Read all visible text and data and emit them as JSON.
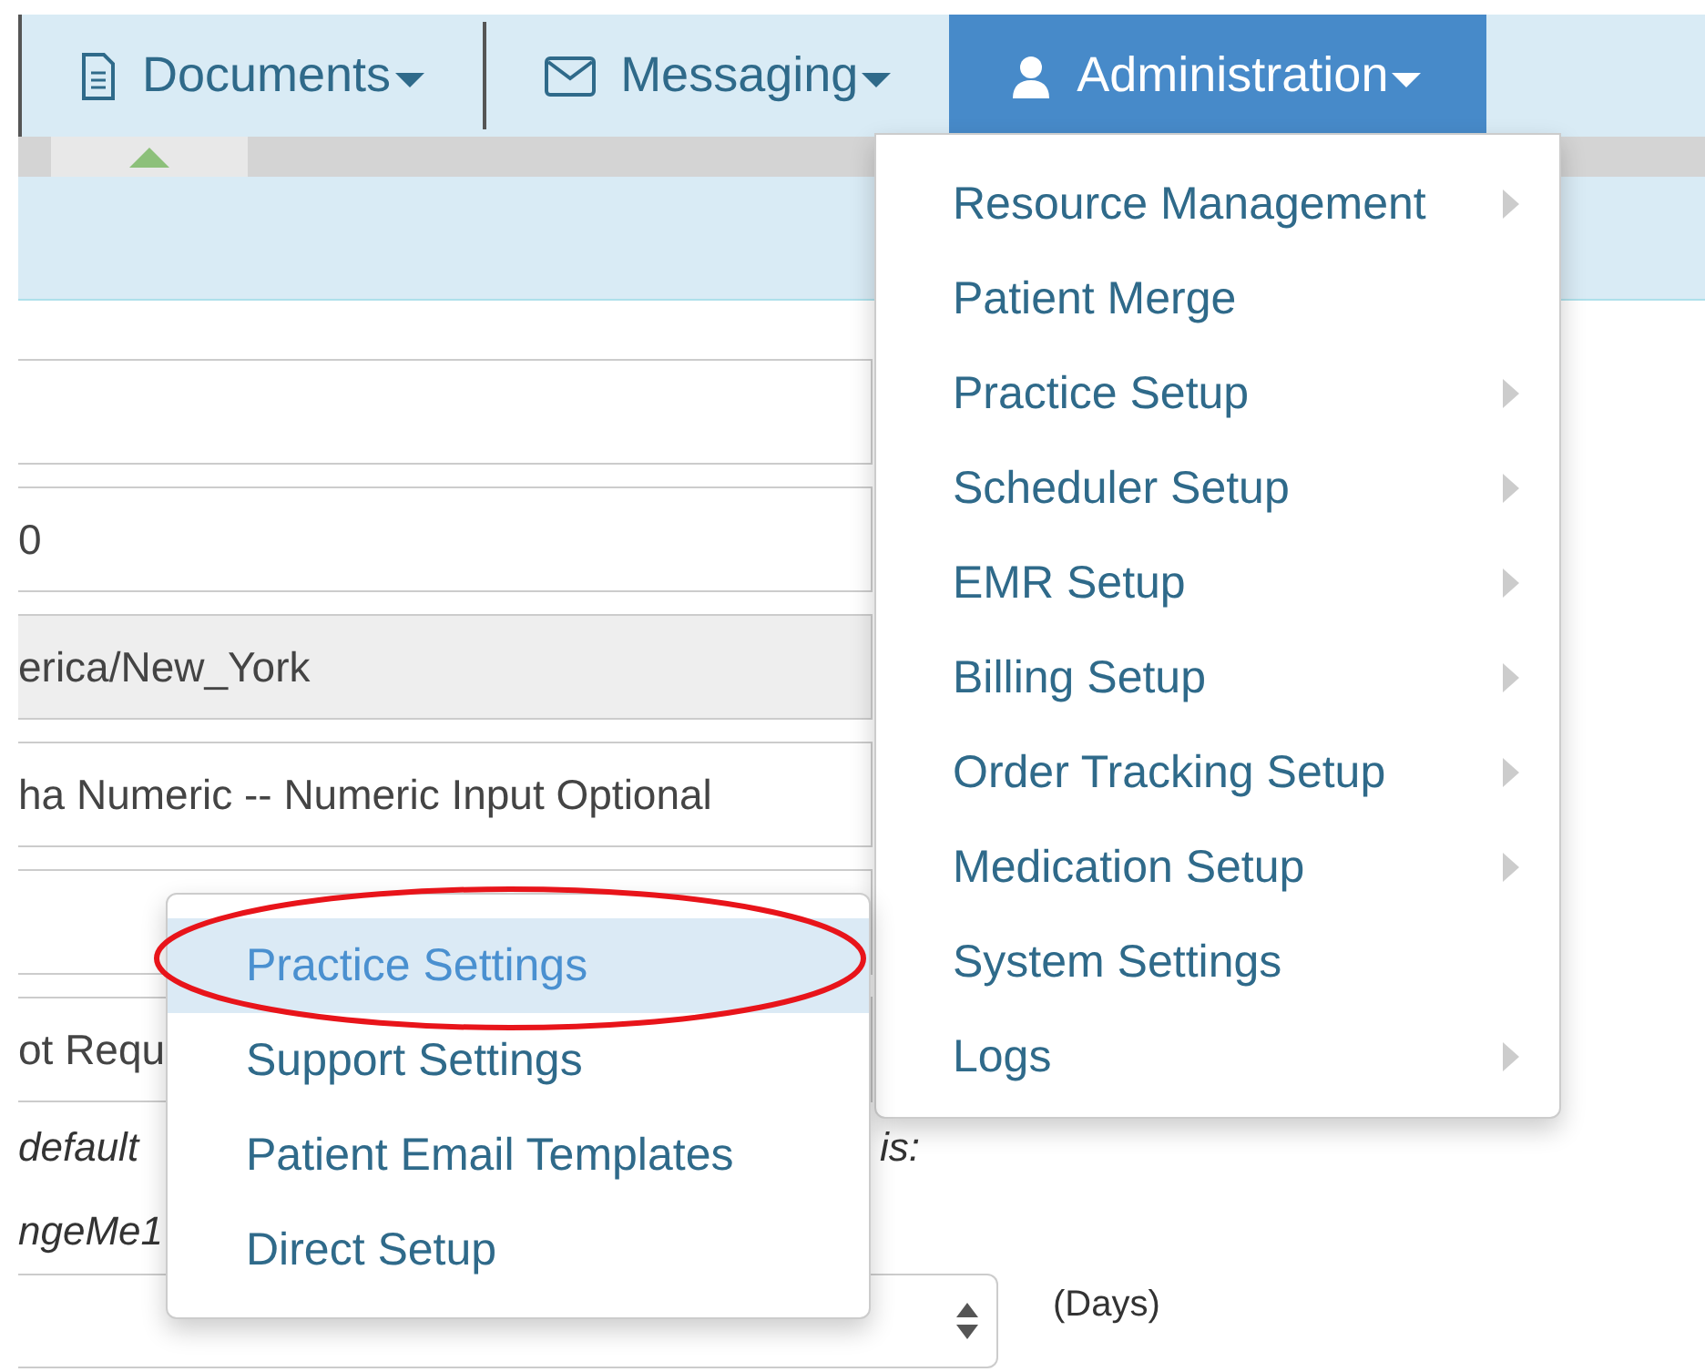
{
  "nav": {
    "tabs": [
      {
        "label": "Documents",
        "selected": false
      },
      {
        "label": "Messaging",
        "selected": false
      },
      {
        "label": "Administration",
        "selected": true
      }
    ]
  },
  "form": {
    "fields": [
      {
        "kind": "input",
        "disabled": false
      },
      {
        "kind": "input",
        "value": "0",
        "disabled": false
      },
      {
        "kind": "input",
        "value": "erica/New_York",
        "disabled": true
      },
      {
        "kind": "input",
        "value": "ha Numeric -- Numeric Input Optional",
        "disabled": false
      },
      {
        "kind": "input",
        "disabled": false
      },
      {
        "kind": "input",
        "value": "ot Requ",
        "disabled": false
      }
    ],
    "note_lines": [
      [
        "default",
        "is:"
      ],
      [
        "ngeMe1"
      ]
    ],
    "select": {
      "unit": "(Days)"
    }
  },
  "admin_menu": {
    "items": [
      {
        "label": "Resource Management",
        "submenu": true
      },
      {
        "label": "Patient Merge",
        "submenu": false
      },
      {
        "label": "Practice Setup",
        "submenu": true
      },
      {
        "label": "Scheduler Setup",
        "submenu": true
      },
      {
        "label": "EMR Setup",
        "submenu": true
      },
      {
        "label": "Billing Setup",
        "submenu": true
      },
      {
        "label": "Order Tracking Setup",
        "submenu": true
      },
      {
        "label": "Medication Setup",
        "submenu": true
      },
      {
        "label": "System Settings",
        "submenu": false
      },
      {
        "label": "Logs",
        "submenu": true
      }
    ]
  },
  "submenu": {
    "items": [
      {
        "label": "Practice Settings",
        "selected": true
      },
      {
        "label": "Support Settings",
        "selected": false
      },
      {
        "label": "Patient Email Templates",
        "selected": false
      },
      {
        "label": "Direct Setup",
        "selected": false
      }
    ]
  }
}
